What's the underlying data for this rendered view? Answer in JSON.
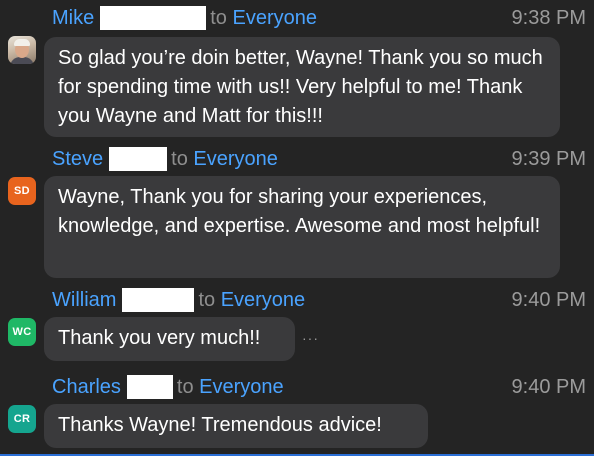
{
  "messages": [
    {
      "sender": "Mike",
      "to_label": "to",
      "to_target": "Everyone",
      "time": "9:38 PM",
      "avatar": {
        "type": "photo",
        "initials": "",
        "color": ""
      },
      "text": "So glad you’re doin better, Wayne!  Thank you so much for spending time with us!!  Very helpful to me! Thank you Wayne and Matt for this!!!"
    },
    {
      "sender": "Steve",
      "to_label": "to",
      "to_target": "Everyone",
      "time": "9:39 PM",
      "avatar": {
        "type": "initials",
        "initials": "SD",
        "color": "#e8641e"
      },
      "text": "Wayne, Thank you for sharing your experiences, knowledge, and expertise. Awesome and most helpful!"
    },
    {
      "sender": "William",
      "to_label": "to",
      "to_target": "Everyone",
      "time": "9:40 PM",
      "avatar": {
        "type": "initials",
        "initials": "WC",
        "color": "#1fb866"
      },
      "text": "Thank you very much!!",
      "more_label": "···"
    },
    {
      "sender": "Charles",
      "to_label": "to",
      "to_target": "Everyone",
      "time": "9:40 PM",
      "avatar": {
        "type": "initials",
        "initials": "CR",
        "color": "#15a58f"
      },
      "text": "Thanks Wayne! Tremendous advice!"
    }
  ]
}
